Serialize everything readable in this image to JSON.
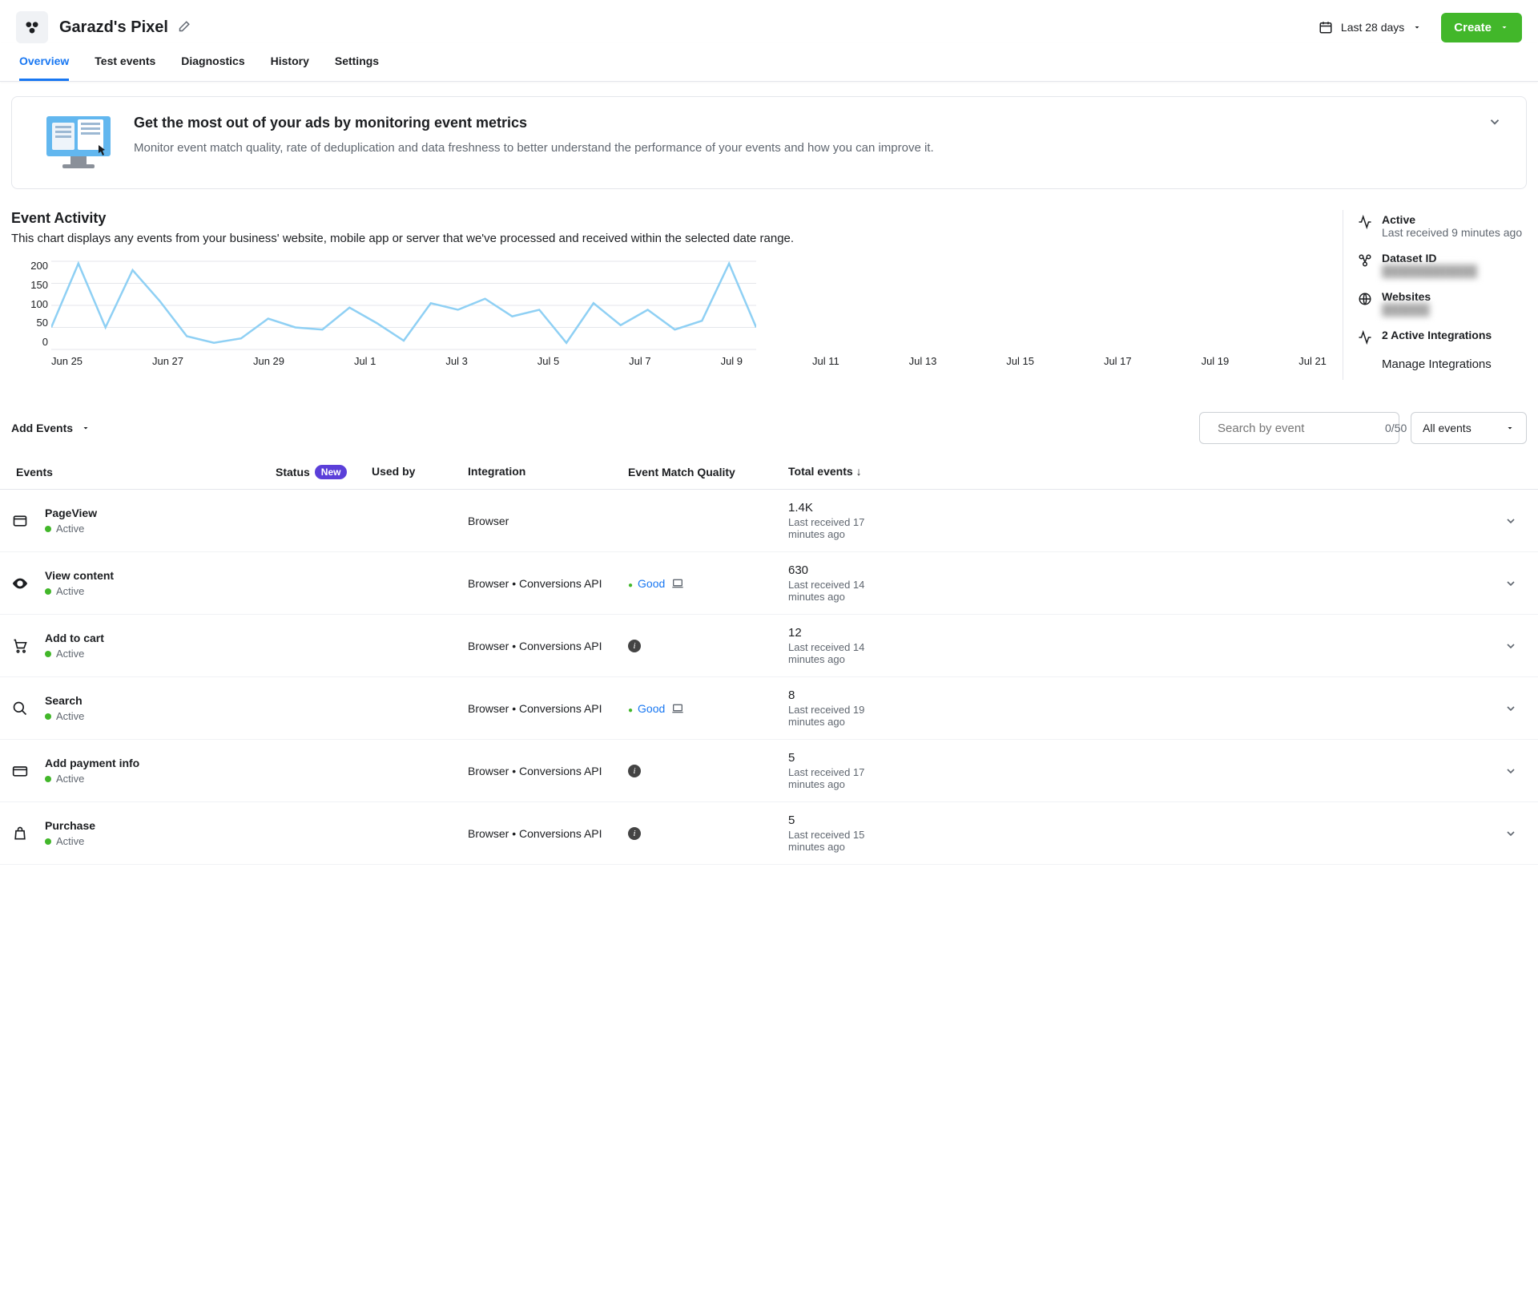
{
  "header": {
    "title": "Garazd's Pixel",
    "date_range_label": "Last 28 days",
    "create_label": "Create"
  },
  "tabs": [
    "Overview",
    "Test events",
    "Diagnostics",
    "History",
    "Settings"
  ],
  "active_tab_index": 0,
  "promo": {
    "title": "Get the most out of your ads by monitoring event metrics",
    "description": "Monitor event match quality, rate of deduplication and data freshness to better understand the performance of your events and how you can improve it."
  },
  "activity": {
    "title": "Event Activity",
    "description": "This chart displays any events from your business' website, mobile app or server that we've processed and received within the selected date range."
  },
  "chart_data": {
    "type": "line",
    "title": "Event Activity",
    "xlabel": "",
    "ylabel": "",
    "ylim": [
      0,
      200
    ],
    "y_ticks": [
      200,
      150,
      100,
      50,
      0
    ],
    "categories": [
      "Jun 25",
      "Jun 27",
      "Jun 29",
      "Jul 1",
      "Jul 3",
      "Jul 5",
      "Jul 7",
      "Jul 9",
      "Jul 11",
      "Jul 13",
      "Jul 15",
      "Jul 17",
      "Jul 19",
      "Jul 21"
    ],
    "series": [
      {
        "name": "Events",
        "color": "#8fd0f4",
        "values": [
          50,
          195,
          50,
          180,
          110,
          30,
          15,
          25,
          70,
          50,
          45,
          95,
          60,
          20,
          105,
          90,
          115,
          75,
          90,
          15,
          105,
          55,
          90,
          45,
          65,
          195,
          50
        ]
      }
    ]
  },
  "sidebar": {
    "active_label": "Active",
    "active_sub": "Last received 9 minutes ago",
    "dataset_label": "Dataset ID",
    "dataset_value": "████████████",
    "websites_label": "Websites",
    "websites_value": "██████",
    "integrations_label": "2 Active Integrations",
    "manage_link": "Manage Integrations"
  },
  "events_toolbar": {
    "add_events_label": "Add Events",
    "search_placeholder": "Search by event",
    "search_counter": "0/50",
    "filter_label": "All events"
  },
  "table": {
    "headers": {
      "events": "Events",
      "status": "Status",
      "status_badge": "New",
      "used_by": "Used by",
      "integration": "Integration",
      "emq": "Event Match Quality",
      "total": "Total events"
    },
    "rows": [
      {
        "icon": "window",
        "name": "PageView",
        "status": "Active",
        "integration": "Browser",
        "emq": null,
        "emq_info": false,
        "total": "1.4K",
        "last": "Last received 17 minutes ago"
      },
      {
        "icon": "eye",
        "name": "View content",
        "status": "Active",
        "integration": "Browser • Conversions API",
        "emq": "Good",
        "emq_info": false,
        "total": "630",
        "last": "Last received 14 minutes ago"
      },
      {
        "icon": "cart",
        "name": "Add to cart",
        "status": "Active",
        "integration": "Browser • Conversions API",
        "emq": null,
        "emq_info": true,
        "total": "12",
        "last": "Last received 14 minutes ago"
      },
      {
        "icon": "search",
        "name": "Search",
        "status": "Active",
        "integration": "Browser • Conversions API",
        "emq": "Good",
        "emq_info": false,
        "total": "8",
        "last": "Last received 19 minutes ago"
      },
      {
        "icon": "card",
        "name": "Add payment info",
        "status": "Active",
        "integration": "Browser • Conversions API",
        "emq": null,
        "emq_info": true,
        "total": "5",
        "last": "Last received 17 minutes ago"
      },
      {
        "icon": "bag",
        "name": "Purchase",
        "status": "Active",
        "integration": "Browser • Conversions API",
        "emq": null,
        "emq_info": true,
        "total": "5",
        "last": "Last received 15 minutes ago"
      }
    ]
  }
}
